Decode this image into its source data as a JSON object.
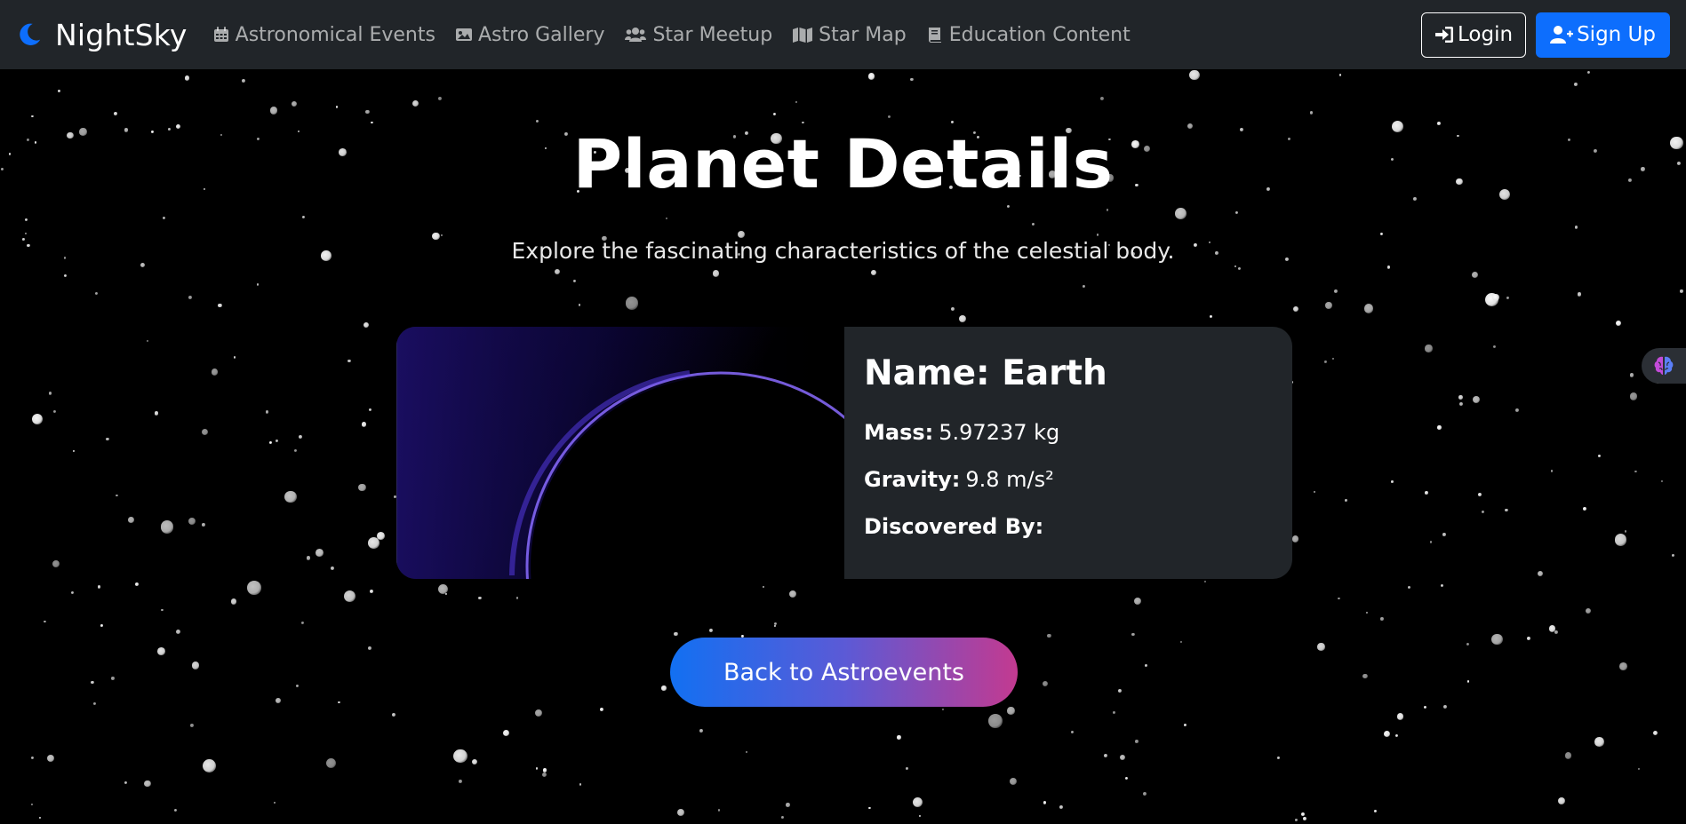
{
  "brand": {
    "name": "NightSky"
  },
  "nav": {
    "links": [
      {
        "label": "Astronomical Events",
        "icon": "calendar-icon"
      },
      {
        "label": "Astro Gallery",
        "icon": "image-icon"
      },
      {
        "label": "Star Meetup",
        "icon": "users-icon"
      },
      {
        "label": "Star Map",
        "icon": "map-icon"
      },
      {
        "label": "Education Content",
        "icon": "book-icon"
      }
    ],
    "login_label": "Login",
    "signup_label": "Sign Up"
  },
  "page": {
    "title": "Planet Details",
    "subtitle": "Explore the fascinating characteristics of the celestial body."
  },
  "planet": {
    "name": "Name: Earth",
    "mass_label": "Mass:",
    "mass_value": "5.97237 kg",
    "gravity_label": "Gravity:",
    "gravity_value": "9.8 m/s²",
    "discovered_label": "Discovered By:",
    "discovered_value": ""
  },
  "back_button": {
    "label": "Back to Astroevents"
  },
  "colors": {
    "navbar_bg": "#212529",
    "primary": "#0d6efd",
    "card_bg": "#212529",
    "gradient_start": "#1270f2",
    "gradient_end": "#c33a90"
  },
  "side_tab": {
    "icon": "brain-icon"
  }
}
